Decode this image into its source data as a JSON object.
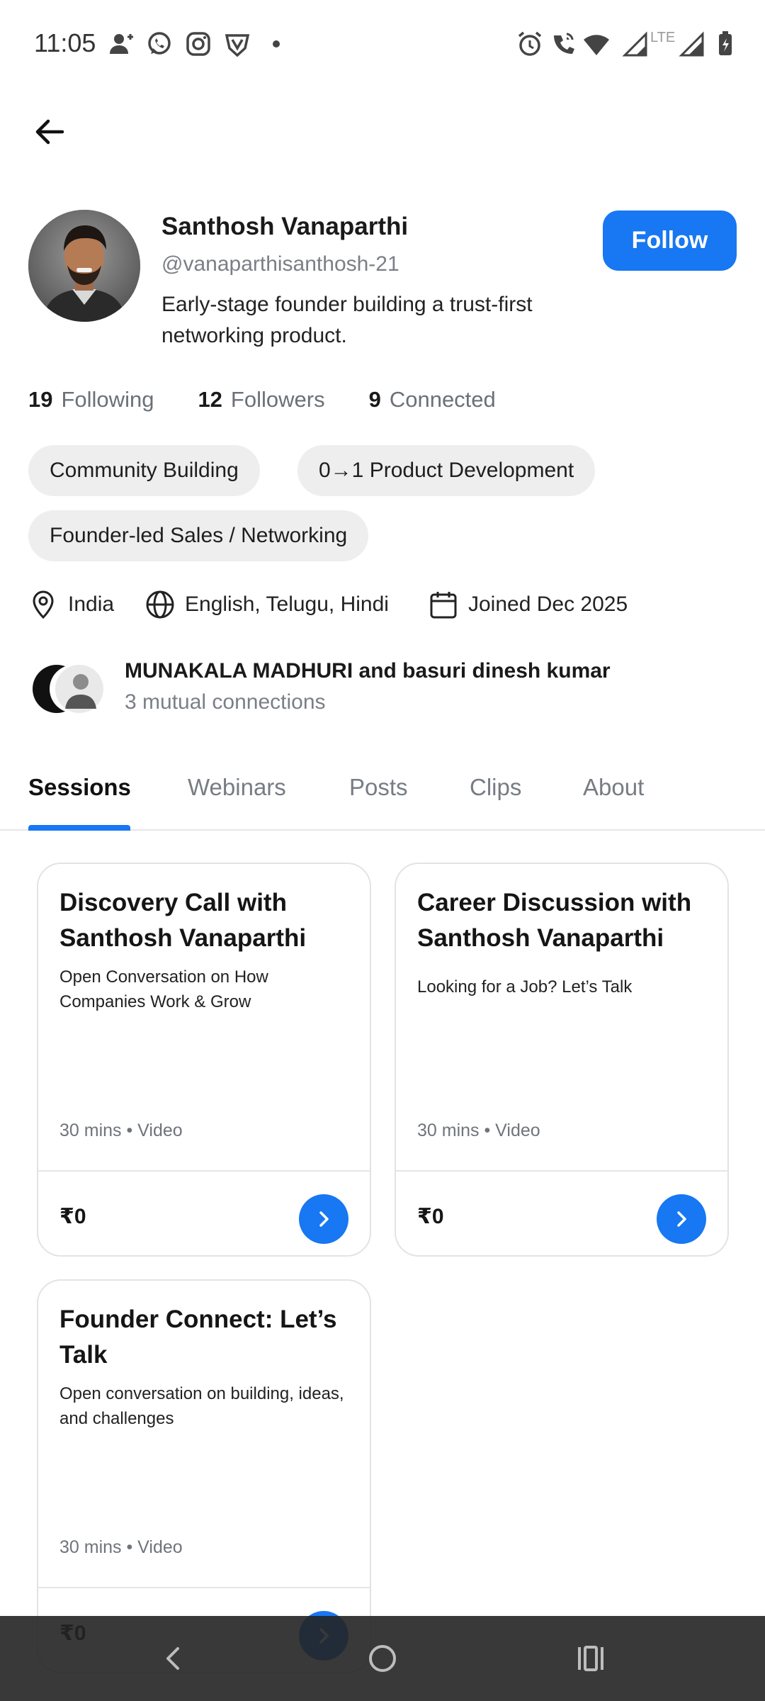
{
  "status_bar": {
    "time": "11:05",
    "left_icons": [
      "person-add-icon",
      "whatsapp-icon",
      "instagram-icon",
      "vpn-shield-icon",
      "dot-icon"
    ],
    "right_icons": [
      "alarm-icon",
      "wifi-call-icon",
      "wifi-icon",
      "signal-lte-icon",
      "signal-icon",
      "battery-charging-icon"
    ],
    "lte_label": "LTE"
  },
  "profile": {
    "name": "Santhosh Vanaparthi",
    "handle": "@vanaparthisanthosh-21",
    "bio": "Early-stage founder building a trust-first networking product.",
    "follow_label": "Follow"
  },
  "stats": [
    {
      "value": "19",
      "label": "Following"
    },
    {
      "value": "12",
      "label": "Followers"
    },
    {
      "value": "9",
      "label": "Connected"
    }
  ],
  "chips": [
    "Community Building",
    "0→1 Product Development",
    "Founder-led Sales / Networking"
  ],
  "meta": {
    "location": "India",
    "languages": "English, Telugu, Hindi",
    "joined": "Joined Dec 2025"
  },
  "mutual": {
    "names": "MUNAKALA MADHURI and basuri dinesh kumar",
    "count": "3 mutual connections"
  },
  "tabs": [
    "Sessions",
    "Webinars",
    "Posts",
    "Clips",
    "About"
  ],
  "active_tab": "Sessions",
  "sessions": [
    {
      "title": "Discovery Call with Santhosh Vanaparthi",
      "desc": "Open Conversation on How Companies Work & Grow",
      "meta": "30 mins • Video",
      "price": "₹0"
    },
    {
      "title": "Career Discussion with Santhosh Vanaparthi",
      "desc": "Looking for a Job? Let’s Talk",
      "meta": "30 mins • Video",
      "price": "₹0"
    },
    {
      "title": "Founder Connect: Let’s Talk",
      "desc": "Open conversation on building, ideas, and challenges",
      "meta": "30 mins • Video",
      "price": "₹0"
    }
  ],
  "colors": {
    "accent": "#1877f2",
    "chip_bg": "#eeeeee",
    "muted": "#7a7f87"
  }
}
